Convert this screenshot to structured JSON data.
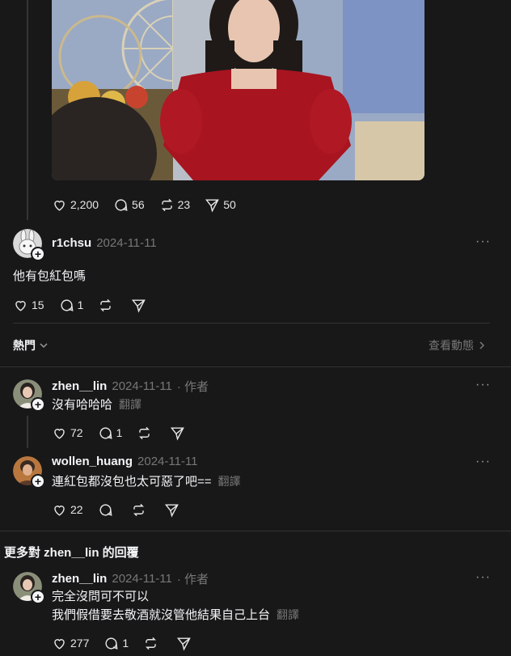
{
  "main_post": {
    "likes": "2,200",
    "comments": "56",
    "reposts": "23",
    "shares": "50"
  },
  "reply1": {
    "username": "r1chsu",
    "date": "2024-11-11",
    "text": "他有包紅包嗎",
    "likes": "15",
    "comments": "1"
  },
  "sort": {
    "label": "熱門",
    "view_activity": "查看動態"
  },
  "comment1": {
    "username": "zhen__lin",
    "date": "2024-11-11",
    "author_tag": "· 作者",
    "text": "沒有哈哈哈",
    "translate": "翻譯",
    "likes": "72",
    "comments": "1"
  },
  "comment2": {
    "username": "wollen_huang",
    "date": "2024-11-11",
    "text": "連紅包都沒包也太可惡了吧==",
    "translate": "翻譯",
    "likes": "22"
  },
  "more_replies": {
    "heading": "更多對 zhen__lin 的回覆"
  },
  "comment3": {
    "username": "zhen__lin",
    "date": "2024-11-11",
    "author_tag": "· 作者",
    "line1": "完全沒問可不可以",
    "line2": "我們假借要去敬酒就沒管他結果自己上台",
    "translate": "翻譯",
    "likes": "277",
    "comments": "1"
  },
  "colors": {
    "background": "#181818",
    "text": "#f3f5f7",
    "muted": "#777777",
    "divider": "#323232"
  },
  "icons": [
    "heart-icon",
    "comment-icon",
    "repost-icon",
    "share-icon",
    "more-icon",
    "chevron-down-icon",
    "chevron-right-icon",
    "plus-icon"
  ]
}
